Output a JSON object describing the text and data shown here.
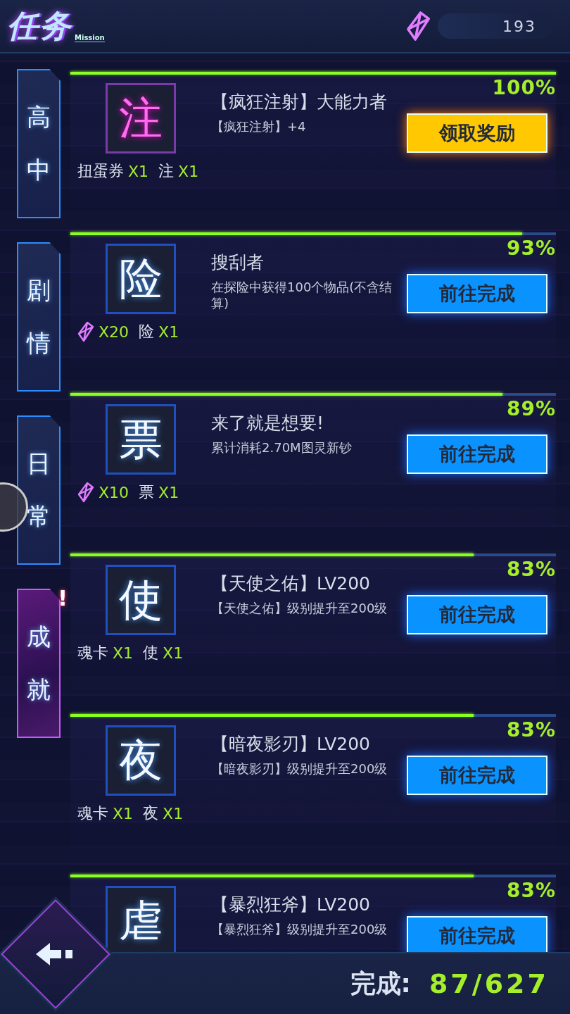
{
  "header": {
    "title": "任务",
    "subtitle": "Mission",
    "currency": "193"
  },
  "tabs": [
    {
      "label": "高中",
      "selected": false
    },
    {
      "label": "剧情",
      "selected": false
    },
    {
      "label": "日常",
      "selected": false
    },
    {
      "label": "成就",
      "selected": true,
      "badge": "!"
    }
  ],
  "tasks": [
    {
      "kind": "claimable",
      "char": "注",
      "title": "【疯狂注射】大能力者",
      "desc": "【疯狂注射】+4",
      "percent": "100%",
      "level": 1.0,
      "button": "领取奖励",
      "rewards": [
        {
          "kind": "text",
          "name": "扭蛋券",
          "count": "X1"
        },
        {
          "kind": "text",
          "name": "注",
          "count": "X1"
        }
      ]
    },
    {
      "kind": "progress",
      "char": "险",
      "title": "搜刮者",
      "desc": "在探险中获得100个物品(不含结算)",
      "percent": "93%",
      "level": 0.93,
      "button": "前往完成",
      "rewards": [
        {
          "kind": "gem",
          "count": "X20"
        },
        {
          "kind": "text",
          "name": "险",
          "count": "X1"
        }
      ]
    },
    {
      "kind": "progress",
      "char": "票",
      "title": "来了就是想要!",
      "desc": "累计消耗2.70M图灵新钞",
      "percent": "89%",
      "level": 0.89,
      "button": "前往完成",
      "rewards": [
        {
          "kind": "gem",
          "count": "X10"
        },
        {
          "kind": "text",
          "name": "票",
          "count": "X1"
        }
      ]
    },
    {
      "kind": "progress",
      "char": "使",
      "title": "【天使之佑】LV200",
      "desc": "【天使之佑】级别提升至200级",
      "percent": "83%",
      "level": 0.83,
      "button": "前往完成",
      "rewards": [
        {
          "kind": "text",
          "name": "魂卡",
          "count": "X1"
        },
        {
          "kind": "text",
          "name": "使",
          "count": "X1"
        }
      ]
    },
    {
      "kind": "progress",
      "char": "夜",
      "title": "【暗夜影刃】LV200",
      "desc": "【暗夜影刃】级别提升至200级",
      "percent": "83%",
      "level": 0.83,
      "button": "前往完成",
      "rewards": [
        {
          "kind": "text",
          "name": "魂卡",
          "count": "X1"
        },
        {
          "kind": "text",
          "name": "夜",
          "count": "X1"
        }
      ]
    },
    {
      "kind": "progress",
      "char": "虐",
      "title": "【暴烈狂斧】LV200",
      "desc": "【暴烈狂斧】级别提升至200级",
      "percent": "83%",
      "level": 0.83,
      "button": "前往完成"
    }
  ],
  "footer": {
    "label": "完成:",
    "value": "87/627"
  }
}
